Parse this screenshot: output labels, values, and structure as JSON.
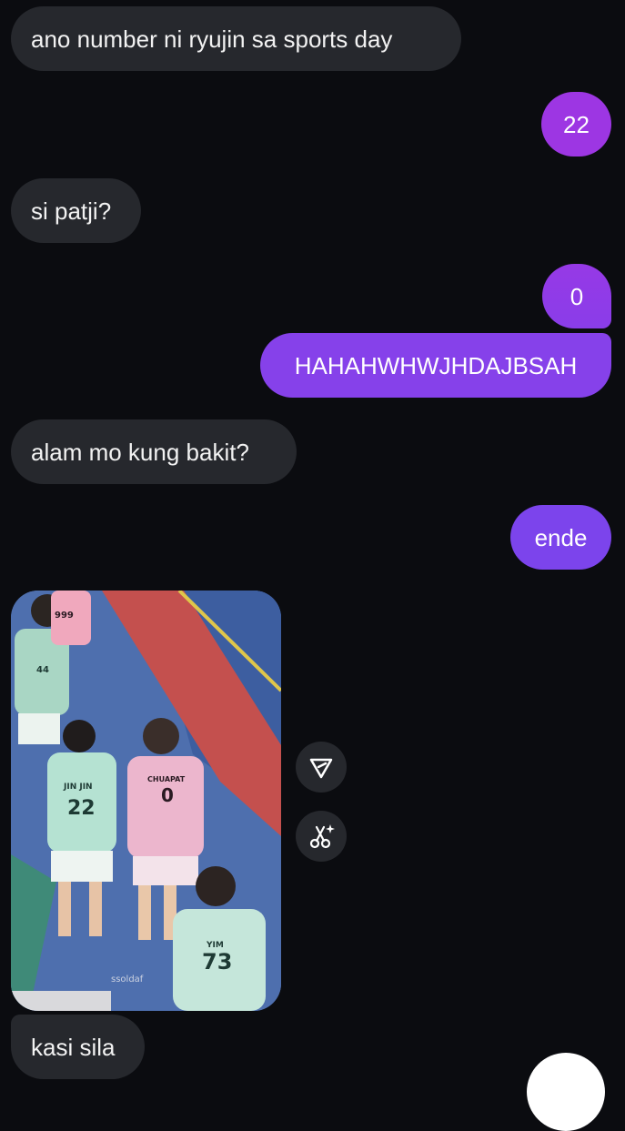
{
  "messages": [
    {
      "side": "in",
      "text": "ano number ni ryujin sa sports day"
    },
    {
      "side": "out",
      "text": "22"
    },
    {
      "side": "in",
      "text": "si patji?"
    },
    {
      "side": "out",
      "text": "0"
    },
    {
      "side": "out",
      "text": "HAHAHWHWJHDAJBSAH"
    },
    {
      "side": "in",
      "text": "alam mo kung bakit?"
    },
    {
      "side": "out",
      "text": "ende"
    },
    {
      "side": "in",
      "text": "kasi sila"
    }
  ],
  "media": {
    "jerseys": {
      "player_left_name": "JIN JIN",
      "player_left_number": "22",
      "player_center_name": "CHUAPAT",
      "player_center_number": "0",
      "player_front_name": "YIM",
      "player_front_number": "73",
      "player_back_left_number": "44",
      "player_back_pink_number": "999"
    },
    "watermark": "ssoldaf"
  },
  "actions": {
    "share_icon": "send-icon",
    "remix_icon": "scissors-sparkle-icon"
  },
  "colors": {
    "background": "#0b0c10",
    "incoming_bubble": "#26282d",
    "outgoing_purple_top": "#9d36e3",
    "outgoing_purple_bottom": "#7c44ec"
  }
}
